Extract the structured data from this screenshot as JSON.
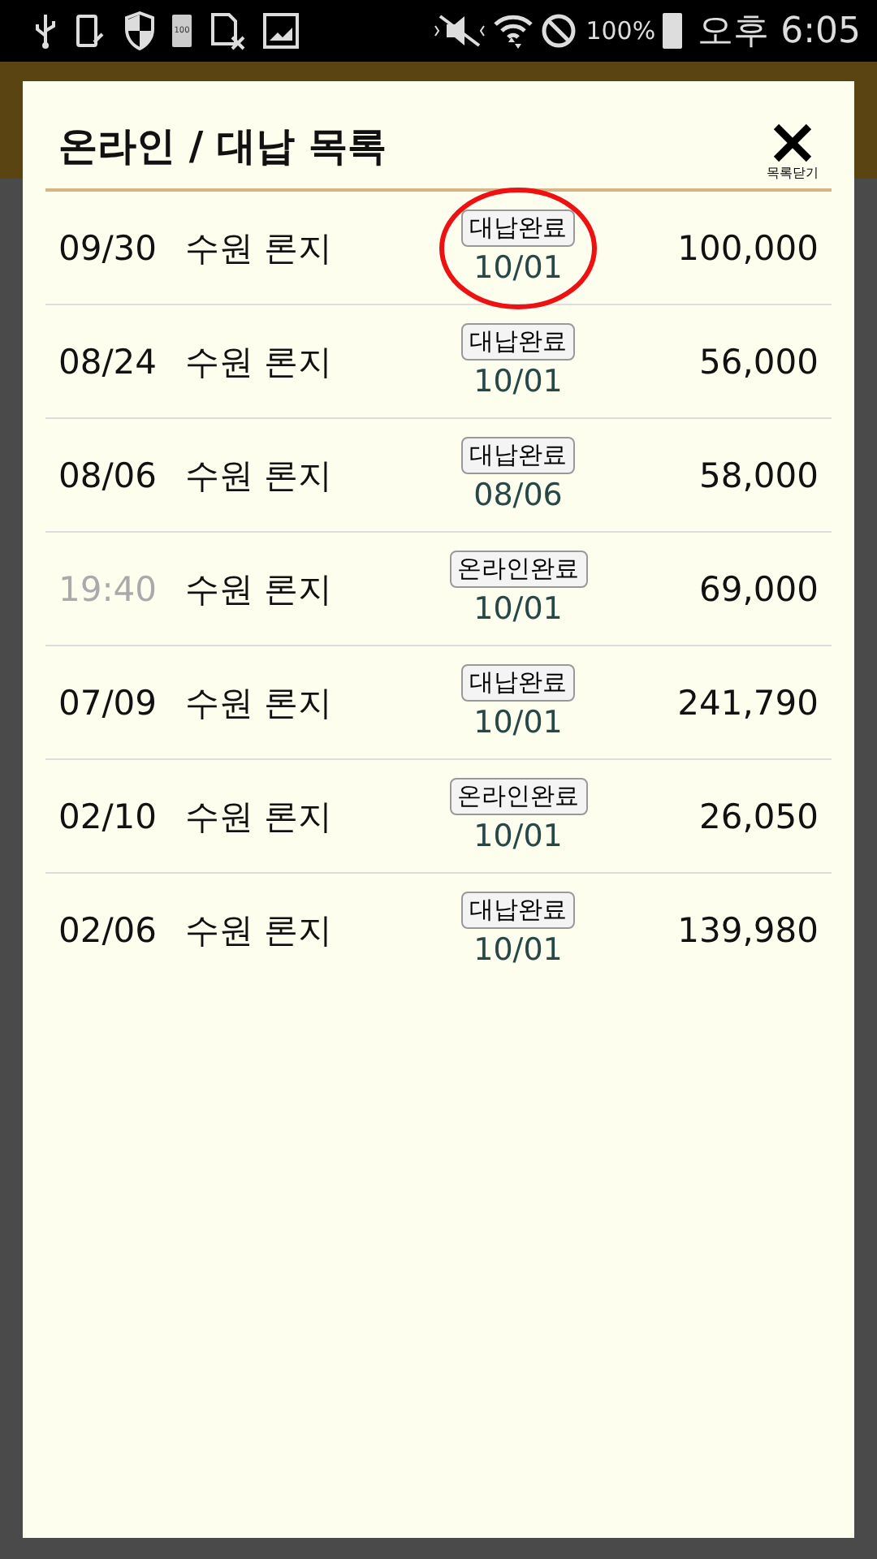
{
  "status_bar": {
    "icon_label": "100",
    "battery": "100%",
    "time": "오후 6:05"
  },
  "dialog": {
    "title": "온라인 / 대납 목록",
    "close_label": "목록닫기"
  },
  "rows": [
    {
      "date": "09/30",
      "date_muted": false,
      "name": "수원 론지",
      "status": "대납완료",
      "status_date": "10/01",
      "amount": "100,000",
      "circled": true
    },
    {
      "date": "08/24",
      "date_muted": false,
      "name": "수원 론지",
      "status": "대납완료",
      "status_date": "10/01",
      "amount": "56,000",
      "circled": false
    },
    {
      "date": "08/06",
      "date_muted": false,
      "name": "수원 론지",
      "status": "대납완료",
      "status_date": "08/06",
      "amount": "58,000",
      "circled": false
    },
    {
      "date": "19:40",
      "date_muted": true,
      "name": "수원 론지",
      "status": "온라인완료",
      "status_date": "10/01",
      "amount": "69,000",
      "circled": false
    },
    {
      "date": "07/09",
      "date_muted": false,
      "name": "수원 론지",
      "status": "대납완료",
      "status_date": "10/01",
      "amount": "241,790",
      "circled": false
    },
    {
      "date": "02/10",
      "date_muted": false,
      "name": "수원 론지",
      "status": "온라인완료",
      "status_date": "10/01",
      "amount": "26,050",
      "circled": false
    },
    {
      "date": "02/06",
      "date_muted": false,
      "name": "수원 론지",
      "status": "대납완료",
      "status_date": "10/01",
      "amount": "139,980",
      "circled": false
    }
  ]
}
